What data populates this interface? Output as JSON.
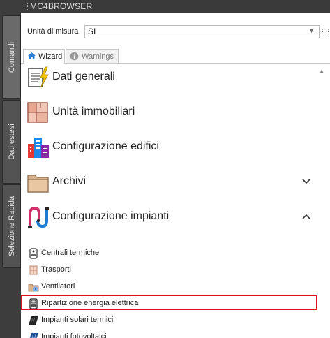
{
  "window": {
    "title": "MC4BROWSER"
  },
  "side_tabs": [
    {
      "label": "Comandi",
      "active": true
    },
    {
      "label": "Dati estesi",
      "active": false
    },
    {
      "label": "Selezione Rapida",
      "active": false
    }
  ],
  "unit": {
    "label": "Unità di misura",
    "value": "SI"
  },
  "tabs": [
    {
      "label": "Wizard",
      "icon": "home-icon",
      "active": true
    },
    {
      "label": "Warnings",
      "icon": "info-icon",
      "active": false
    }
  ],
  "categories": [
    {
      "label": "Dati generali",
      "icon": "document-lightning-icon"
    },
    {
      "label": "Unità immobiliari",
      "icon": "floorplan-icon"
    },
    {
      "label": "Configurazione edifici",
      "icon": "buildings-icon"
    },
    {
      "label": "Archivi",
      "icon": "folder-icon",
      "expanded": false
    },
    {
      "label": "Configurazione impianti",
      "icon": "pipes-icon",
      "expanded": true
    }
  ],
  "subitems": [
    {
      "label": "Centrali termiche",
      "icon": "boiler-icon"
    },
    {
      "label": "Trasporti",
      "icon": "transport-icon"
    },
    {
      "label": "Ventilatori",
      "icon": "fan-icon"
    },
    {
      "label": "Ripartizione energia elettrica",
      "icon": "electric-meter-icon",
      "highlighted": true
    },
    {
      "label": "Impianti solari termici",
      "icon": "solar-thermal-icon"
    },
    {
      "label": "Impianti fotovoltaici",
      "icon": "photovoltaic-icon"
    }
  ],
  "colors": {
    "highlight": "#d9141e",
    "accent_blue": "#2a7fd4"
  }
}
